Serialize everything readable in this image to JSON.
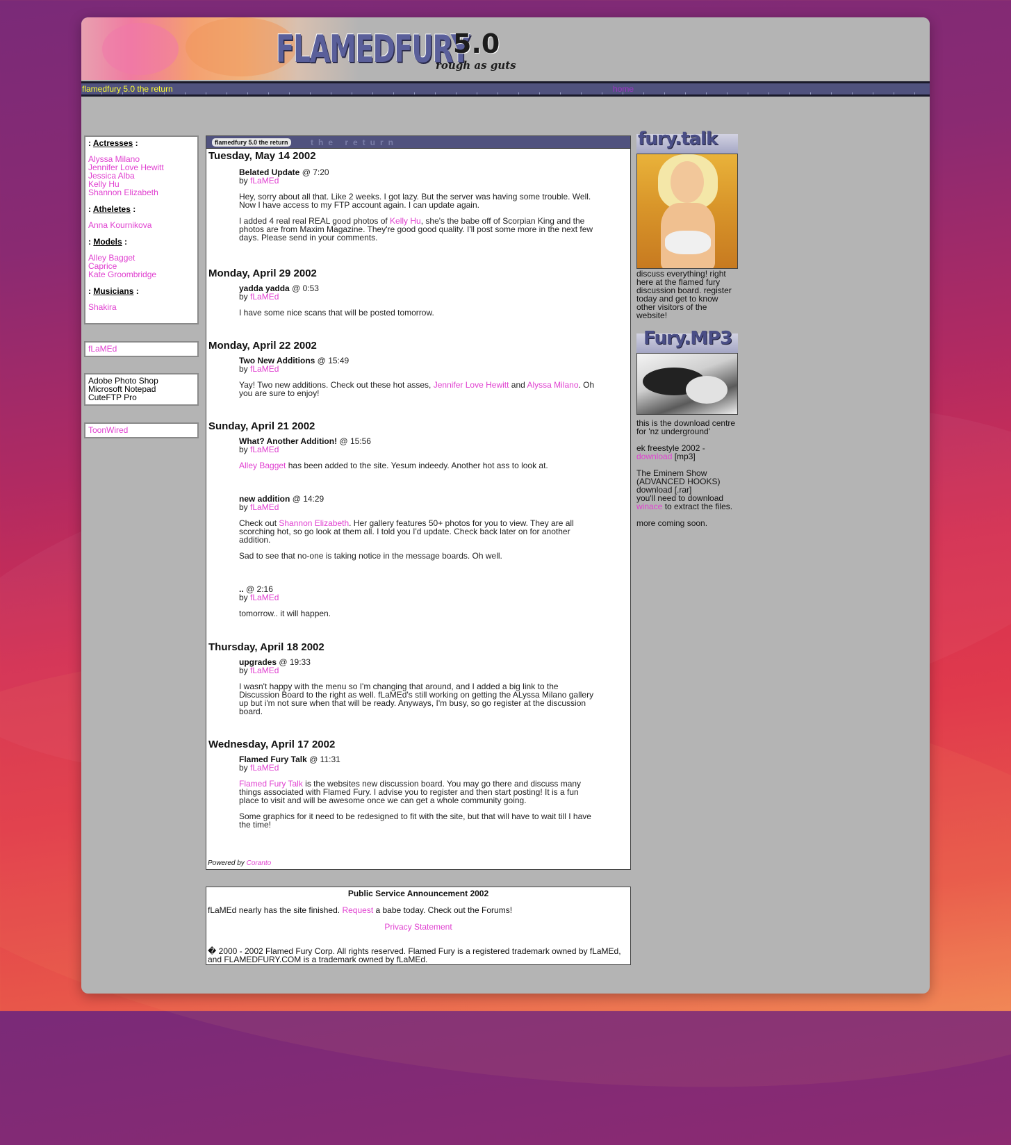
{
  "header": {
    "logo_main": "FLAMEDFURY",
    "logo_version": "5.0",
    "logo_tagline": "rough as guts",
    "nav_title": "flamedfury 5.0 the return",
    "nav_home": "home"
  },
  "sidebar": {
    "categories": [
      {
        "label": "Actresses",
        "items": [
          "Alyssa Milano",
          "Jennifer Love Hewitt",
          "Jessica Alba",
          "Kelly Hu",
          "Shannon Elizabeth"
        ]
      },
      {
        "label": "Atheletes",
        "items": [
          "Anna Kournikova"
        ]
      },
      {
        "label": "Models",
        "items": [
          "Alley Bagget",
          "Caprice",
          "Kate Groombridge"
        ]
      },
      {
        "label": "Musicians",
        "items": [
          "Shakira"
        ]
      }
    ],
    "author_link": "fLaMEd",
    "tools": [
      "Adobe Photo Shop",
      "Microsoft Notepad",
      "CuteFTP Pro"
    ],
    "partner_link": "ToonWired"
  },
  "main": {
    "header_tag": "flamedfury 5.0 the return",
    "header_ghost": "the return",
    "days": [
      {
        "date": "Tuesday, May 14 2002",
        "posts": [
          {
            "title": "Belated Update",
            "time": "@ 7:20",
            "by": "by",
            "author": "fLaMEd",
            "p1": "Hey, sorry about all that. Like 2 weeks. I got lazy. But the server was having some trouble. Well. Now I have access to my FTP account again. I can update again.",
            "p2a": "I added 4 real real REAL good photos of ",
            "p2link": "Kelly Hu",
            "p2b": ", she's the babe off of Scorpian King and the photos are from Maxim Magazine. They're good good quality. I'll post some more in the next few days. Please send in your comments."
          }
        ]
      },
      {
        "date": "Monday, April 29 2002",
        "posts": [
          {
            "title": "yadda yadda",
            "time": "@ 0:53",
            "by": "by",
            "author": "fLaMEd",
            "p1": "I have some nice scans that will be posted tomorrow."
          }
        ]
      },
      {
        "date": "Monday, April 22 2002",
        "posts": [
          {
            "title": "Two New Additions",
            "time": "@ 15:49",
            "by": "by",
            "author": "fLaMEd",
            "p1a": "Yay! Two new additions. Check out these hot asses, ",
            "l1": "Jennifer Love Hewitt",
            "p1b": " and ",
            "l2": "Alyssa Milano",
            "p1c": ". Oh you are sure to enjoy!"
          }
        ]
      },
      {
        "date": "Sunday, April 21 2002",
        "posts": [
          {
            "title": "What? Another Addition!",
            "time": "@ 15:56",
            "by": "by",
            "author": "fLaMEd",
            "l1": "Alley Bagget",
            "p1b": " has been added to the site. Yesum indeedy. Another hot ass to look at."
          },
          {
            "title": "new addition",
            "time": "@ 14:29",
            "by": "by",
            "author": "fLaMEd",
            "p1a": "Check out ",
            "l1": "Shannon Elizabeth",
            "p1b": ". Her gallery features 50+ photos for you to view. They are all scorching hot, so go look at them all. I told you I'd update. Check back later on for another addition.",
            "p2": "Sad to see that no-one is taking notice in the message boards. Oh well."
          },
          {
            "title": "..",
            "time": "@ 2:16",
            "by": "by",
            "author": "fLaMEd",
            "p1": "tomorrow.. it will happen."
          }
        ]
      },
      {
        "date": "Thursday, April 18 2002",
        "posts": [
          {
            "title": "upgrades",
            "time": "@ 19:33",
            "by": "by",
            "author": "fLaMEd",
            "p1": "I wasn't happy with the menu so I'm changing that around, and I added a big link to the Discussion Board to the right as well. fLaMEd's still working on getting the ALyssa Milano gallery up but i'm not sure when that will be ready. Anyways, I'm busy, so go register at the discussion board."
          }
        ]
      },
      {
        "date": "Wednesday, April 17 2002",
        "posts": [
          {
            "title": "Flamed Fury Talk",
            "time": "@ 11:31",
            "by": "by",
            "author": "fLaMEd",
            "l1": "Flamed Fury Talk",
            "p1b": " is the websites new discussion board. You may go there and discuss many things associated with Flamed Fury. I advise you to register and then start posting! It is a fun place to visit and will be awesome once we can get a whole community going.",
            "p2": "Some graphics for it need to be redesigned to fit with the site, but that will have to wait till I have the time!"
          }
        ]
      }
    ],
    "powered_by": "Powered by",
    "powered_link": "Coranto"
  },
  "psa": {
    "title": "Public Service Announcement 2002",
    "line_a": "fLaMEd nearly has the site finished. ",
    "line_link": "Request",
    "line_b": " a babe today. Check out the Forums!",
    "privacy": "Privacy Statement",
    "copyright": "� 2000 - 2002 Flamed Fury Corp. All rights reserved. Flamed Fury is a registered trademark owned by fLaMEd, and FLAMEDFURY.COM is a trademark owned by fLaMEd."
  },
  "right": {
    "talk_title": "fury.talk",
    "talk_text": "discuss everything! right here at the flamed fury discussion board. register today and get to know other visitors of the website!",
    "mp3_title": "Fury.MP3",
    "mp3_intro": "this is the download centre for 'nz underground'",
    "ek_label": "ek freestyle 2002 -",
    "ek_link": "download",
    "ek_suffix": " [mp3]",
    "eminem_lines": "The Eminem Show (ADVANCED HOOKS) download [.rar]",
    "need_text": "you'll need to download",
    "winace_link": "winace",
    "winace_suffix": " to extract the files.",
    "more": "more coming soon."
  },
  "colors": {
    "link": "#e040d0",
    "nav_bar": "#50527e",
    "nav_title": "#ffff33",
    "window_bg": "#b4b4b4"
  }
}
